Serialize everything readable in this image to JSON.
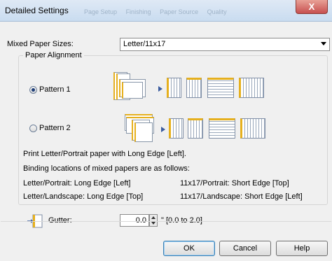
{
  "window": {
    "title": "Detailed Settings",
    "background_tabs": [
      "Page Setup",
      "Finishing",
      "Paper Source",
      "Quality"
    ],
    "close_glyph": "X"
  },
  "mixed_paper": {
    "label": "Mixed Paper Sizes:",
    "value": "Letter/11x17"
  },
  "paper_alignment": {
    "legend": "Paper Alignment",
    "pattern1_label": "Pattern 1",
    "pattern2_label": "Pattern 2",
    "selected": "Pattern 1"
  },
  "info": {
    "line1": "Print Letter/Portrait paper with Long Edge [Left].",
    "line2": "Binding locations of mixed papers are as follows:",
    "col1_row1": "Letter/Portrait: Long Edge [Left]",
    "col1_row2": "Letter/Landscape: Long Edge [Top]",
    "col2_row1": "11x17/Portrait: Short Edge [Top]",
    "col2_row2": "11x17/Landscape: Short Edge [Left]"
  },
  "gutter": {
    "label": "Gutter:",
    "value": "0.0",
    "range": "\" [0.0 to 2.0]",
    "icon": "gutter-margin-icon"
  },
  "buttons": {
    "ok": "OK",
    "cancel": "Cancel",
    "help": "Help"
  },
  "colors": {
    "binding_edge": "#e6b01e",
    "arrow": "#3c5da0",
    "close_button": "#c75050"
  }
}
